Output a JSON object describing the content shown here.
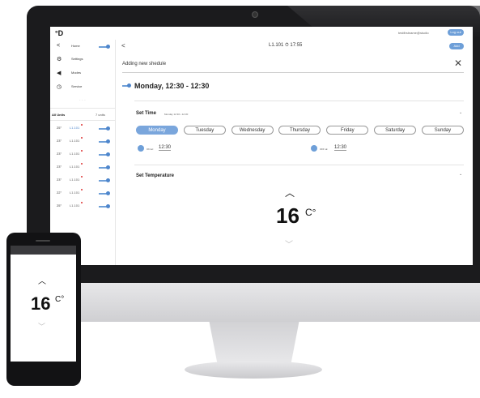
{
  "app": {
    "logo": "°D",
    "user_email": "testfirstname@studio",
    "login_label": "Log out"
  },
  "sidebar": {
    "nav": [
      {
        "icon": "chevron-left-icon",
        "glyph": "<",
        "label": "Home"
      },
      {
        "icon": "gear-icon",
        "glyph": "⚙",
        "label": "Settings"
      },
      {
        "icon": "mode-icon",
        "glyph": "◀",
        "label": "Modes"
      },
      {
        "icon": "clock-icon",
        "glyph": "◷",
        "label": "Service"
      }
    ],
    "more": "· · ·",
    "units_header": "All Units",
    "units_count": "7 units",
    "units": [
      {
        "temp": "25°",
        "name": "L1.101",
        "selected": true
      },
      {
        "temp": "23°",
        "name": "L1.101",
        "selected": false
      },
      {
        "temp": "23°",
        "name": "L1.101",
        "selected": false
      },
      {
        "temp": "23°",
        "name": "L1.101",
        "selected": false
      },
      {
        "temp": "23°",
        "name": "L1.101",
        "selected": false
      },
      {
        "temp": "22°",
        "name": "L1.101",
        "selected": false
      },
      {
        "temp": "25°",
        "name": "L1.101",
        "selected": false
      }
    ]
  },
  "main": {
    "back_glyph": "<",
    "unit_title": "L1.101   ⏱ 17:55",
    "add_label": "Add",
    "schedule_title": "Adding new shedule",
    "close_glyph": "✕",
    "day_header": "Monday, 12:30 - 12:30",
    "set_time": {
      "label": "Set Time",
      "subtitle": "Monday 12:30 • 12:30",
      "chevron": "⌄"
    },
    "days": [
      "Monday",
      "Tuesday",
      "Wednesday",
      "Thursday",
      "Friday",
      "Saturday",
      "Sunday"
    ],
    "active_day": 0,
    "on_time": {
      "label": "ON at:",
      "value": "12:30"
    },
    "off_time": {
      "label": "OFF at:",
      "value": "12:30"
    },
    "set_temperature": {
      "label": "Set Temperature",
      "chevron": "⌄"
    },
    "temperature": {
      "value": "16",
      "unit": "C°",
      "up_glyph": "︿",
      "down_glyph": "﹀"
    }
  },
  "phone": {
    "temperature": {
      "value": "16",
      "unit": "C°",
      "up_glyph": "︿",
      "down_glyph": "﹀"
    }
  },
  "colors": {
    "accent": "#6e9fd8",
    "alert": "#dd3333"
  }
}
